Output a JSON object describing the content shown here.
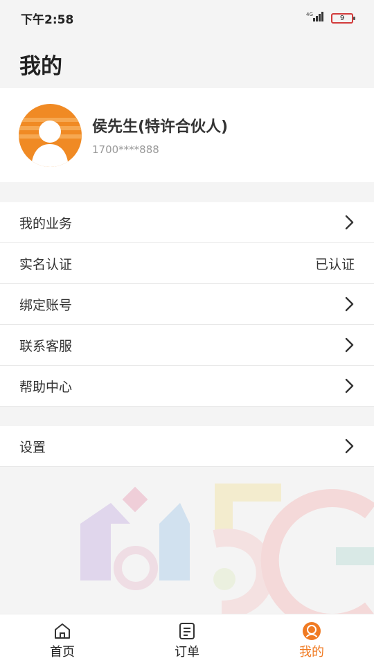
{
  "status": {
    "time": "下午2:58",
    "network": "4G",
    "battery": "9"
  },
  "page": {
    "title": "我的"
  },
  "profile": {
    "name": "侯先生(特许合伙人)",
    "phone": "1700****888"
  },
  "menu": [
    {
      "label": "我的业务",
      "value": "",
      "icon": "chevron-right-icon"
    },
    {
      "label": "实名认证",
      "value": "已认证",
      "icon": ""
    },
    {
      "label": "绑定账号",
      "value": "",
      "icon": "chevron-right-icon"
    },
    {
      "label": "联系客服",
      "value": "",
      "icon": "chevron-right-icon"
    },
    {
      "label": "帮助中心",
      "value": "",
      "icon": "chevron-right-icon"
    }
  ],
  "settings": {
    "label": "设置",
    "icon": "chevron-right-icon"
  },
  "nav": [
    {
      "label": "首页",
      "icon": "home-icon"
    },
    {
      "label": "订单",
      "icon": "order-icon"
    },
    {
      "label": "我的",
      "icon": "profile-icon",
      "active": true
    }
  ],
  "colors": {
    "accent": "#f07a22",
    "background": "#f4f4f4"
  }
}
